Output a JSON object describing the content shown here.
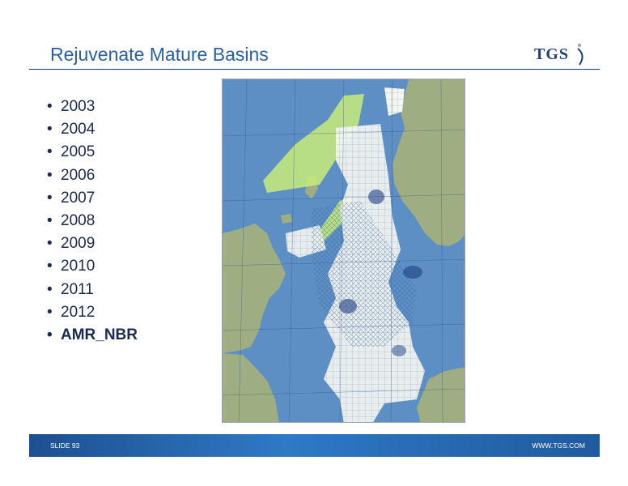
{
  "slide": {
    "title": "Rejuvenate Mature Basins"
  },
  "logo": {
    "text": "TGS"
  },
  "bullets": [
    {
      "label": "2003",
      "bold": false
    },
    {
      "label": "2004",
      "bold": false
    },
    {
      "label": "2005",
      "bold": false
    },
    {
      "label": "2006",
      "bold": false
    },
    {
      "label": "2007",
      "bold": false
    },
    {
      "label": "2008",
      "bold": false
    },
    {
      "label": "2009",
      "bold": false
    },
    {
      "label": "2010",
      "bold": false
    },
    {
      "label": "2011",
      "bold": false
    },
    {
      "label": "2012",
      "bold": false
    },
    {
      "label": "AMR_NBR",
      "bold": true
    }
  ],
  "bullet_glyph": "•",
  "footer": {
    "slide_number": "SLIDE 93",
    "website": "WWW.TGS.COM"
  },
  "colors": {
    "title": "#2a5fa8",
    "sea": "#5e8fc4",
    "land": "#9fae82",
    "coverage_fill": "#eef2f2",
    "highlight": "#c8ec7a",
    "footer": "#1d4f92"
  },
  "map": {
    "description_icon": "north-sea-survey-map"
  }
}
